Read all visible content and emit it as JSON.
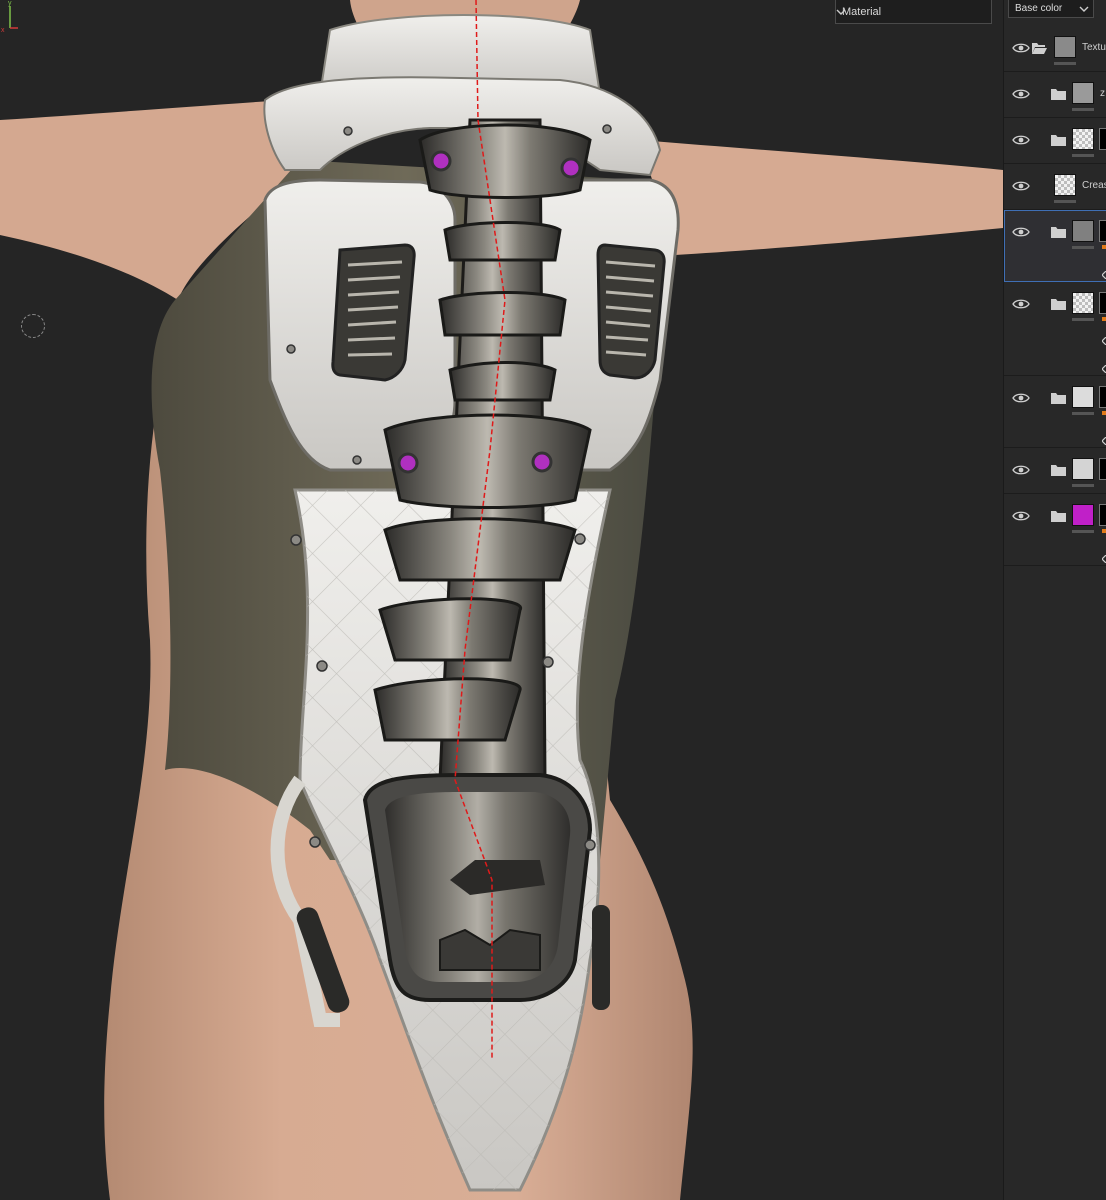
{
  "viewport": {
    "display_mode": "Material",
    "icons": {
      "dropdown": "chevron-down-icon",
      "cursor": "brush-cursor-ring",
      "axis": "axis-gizmo-icon"
    }
  },
  "panel": {
    "channel": "Base color",
    "layers": [
      {
        "name": "Textu",
        "type": "folder-open",
        "thumb_color": "#8a8a8a"
      },
      {
        "name": "z",
        "type": "folder",
        "thumb_color": "#9a9a9a"
      },
      {
        "name": "",
        "type": "folder",
        "thumb_color": "checker"
      },
      {
        "name": "Creas",
        "type": "layer",
        "thumb_color": "checker"
      },
      {
        "name": "",
        "type": "folder",
        "thumb_color": "#808080",
        "selected": true
      },
      {
        "name": "",
        "type": "folder",
        "thumb_color": "checker"
      },
      {
        "name": "",
        "type": "folder",
        "thumb_color": "#dcdcdc"
      },
      {
        "name": "",
        "type": "folder",
        "thumb_color": "#d4d4d4"
      },
      {
        "name": "",
        "type": "folder",
        "thumb_color": "#c020c8"
      }
    ],
    "colors": {
      "accent": "#3f6fb5",
      "mask_indicator": "#e07a1a"
    }
  }
}
